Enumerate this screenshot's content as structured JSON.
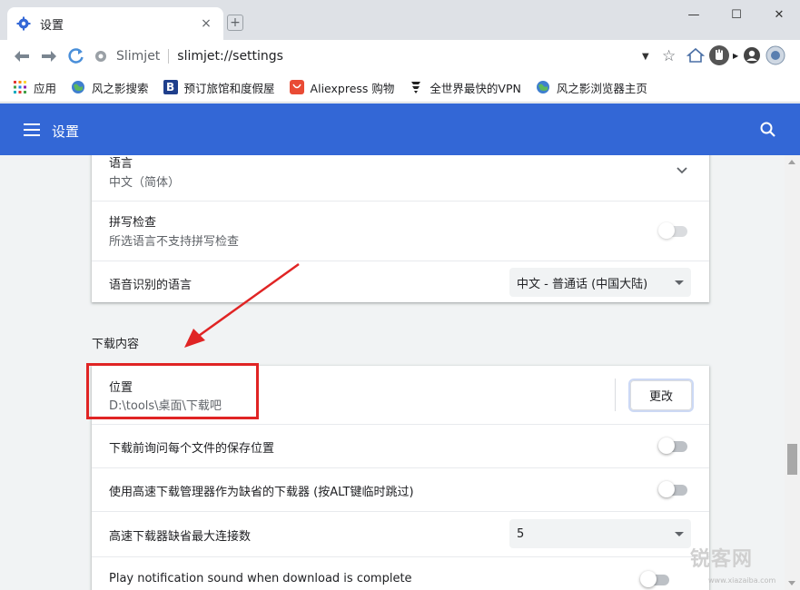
{
  "tab": {
    "title": "设置",
    "close": "×"
  },
  "newtab": {
    "label": "+"
  },
  "window": {
    "minimize": "—",
    "maximize": "☐",
    "close": "✕"
  },
  "toolbar": {
    "site_name": "Slimjet",
    "url": "slimjet://settings"
  },
  "bookmarks": [
    {
      "label": "应用",
      "icon": "apps-grid-icon"
    },
    {
      "label": "风之影搜索",
      "icon": "globe-icon"
    },
    {
      "label": "预订旅馆和度假屋",
      "icon": "booking-icon"
    },
    {
      "label": "Aliexpress 购物",
      "icon": "aliexpress-icon"
    },
    {
      "label": "全世界最快的VPN",
      "icon": "vpn-icon"
    },
    {
      "label": "风之影浏览器主页",
      "icon": "globe-icon"
    }
  ],
  "header": {
    "title": "设置"
  },
  "languages": {
    "language_label": "语言",
    "language_value": "中文（简体）",
    "spell_label": "拼写检查",
    "spell_sub": "所选语言不支持拼写检查",
    "speech_label": "语音识别的语言",
    "speech_value": "中文 - 普通话 (中国大陆)"
  },
  "downloads": {
    "section_title": "下载内容",
    "location_label": "位置",
    "location_value": "D:\\tools\\桌面\\下载吧",
    "change_button": "更改",
    "ask_label": "下载前询问每个文件的保存位置",
    "fast_manager_label": "使用高速下载管理器作为缺省的下载器 (按ALT键临时跳过)",
    "max_conn_label": "高速下载器缺省最大连接数",
    "max_conn_value": "5",
    "sound_label": "Play notification sound when download is complete"
  },
  "watermark": {
    "text": "锐客网",
    "sub": "www.xiazaiba.com"
  },
  "colors": {
    "header": "#3367d6",
    "annotation": "#e02424"
  }
}
